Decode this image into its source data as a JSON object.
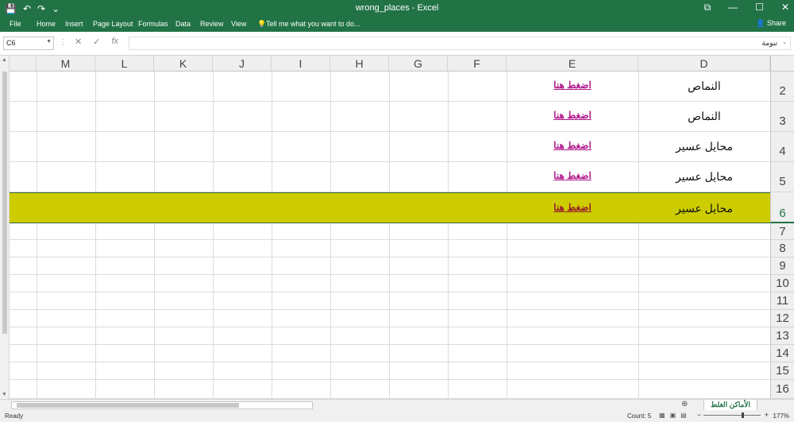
{
  "window": {
    "title": "wrong_places - Excel",
    "qat": [
      "💾",
      "↶",
      "↷",
      "⌄"
    ],
    "controls": [
      "⧉",
      "—",
      "☐",
      "✕"
    ]
  },
  "ribbon": {
    "tabs": [
      "File",
      "Home",
      "Insert",
      "Page Layout",
      "Formulas",
      "Data",
      "Review",
      "View"
    ],
    "tell_me": "Tell me what you want to do...",
    "share": "Share"
  },
  "formula_bar": {
    "name_box": "C6",
    "cancel": "✕",
    "enter": "✓",
    "fx": "fx",
    "value": "تنومة"
  },
  "columns": [
    "M",
    "L",
    "K",
    "J",
    "I",
    "H",
    "G",
    "F",
    "E",
    "D"
  ],
  "rows": [
    {
      "num": "2",
      "d": "النماص",
      "e": "اضغط هنا"
    },
    {
      "num": "3",
      "d": "النماص",
      "e": "اضغط هنا"
    },
    {
      "num": "4",
      "d": "محايل عسير",
      "e": "اضغط هنا"
    },
    {
      "num": "5",
      "d": "محايل عسير",
      "e": "اضغط هنا"
    },
    {
      "num": "6",
      "d": "محايل عسير",
      "e": "اضغط هنا"
    },
    {
      "num": "7",
      "d": "",
      "e": ""
    },
    {
      "num": "8",
      "d": "",
      "e": ""
    },
    {
      "num": "9",
      "d": "",
      "e": ""
    },
    {
      "num": "10",
      "d": "",
      "e": ""
    },
    {
      "num": "11",
      "d": "",
      "e": ""
    },
    {
      "num": "12",
      "d": "",
      "e": ""
    },
    {
      "num": "13",
      "d": "",
      "e": ""
    },
    {
      "num": "14",
      "d": "",
      "e": ""
    },
    {
      "num": "15",
      "d": "",
      "e": ""
    },
    {
      "num": "16",
      "d": "",
      "e": ""
    }
  ],
  "sheet_tab": "الأماكن الغلط",
  "status": {
    "ready": "Ready",
    "count": "Count: 5",
    "zoom": "177%",
    "highlight_color": "#cccc00",
    "link_color": "#b0188c"
  }
}
